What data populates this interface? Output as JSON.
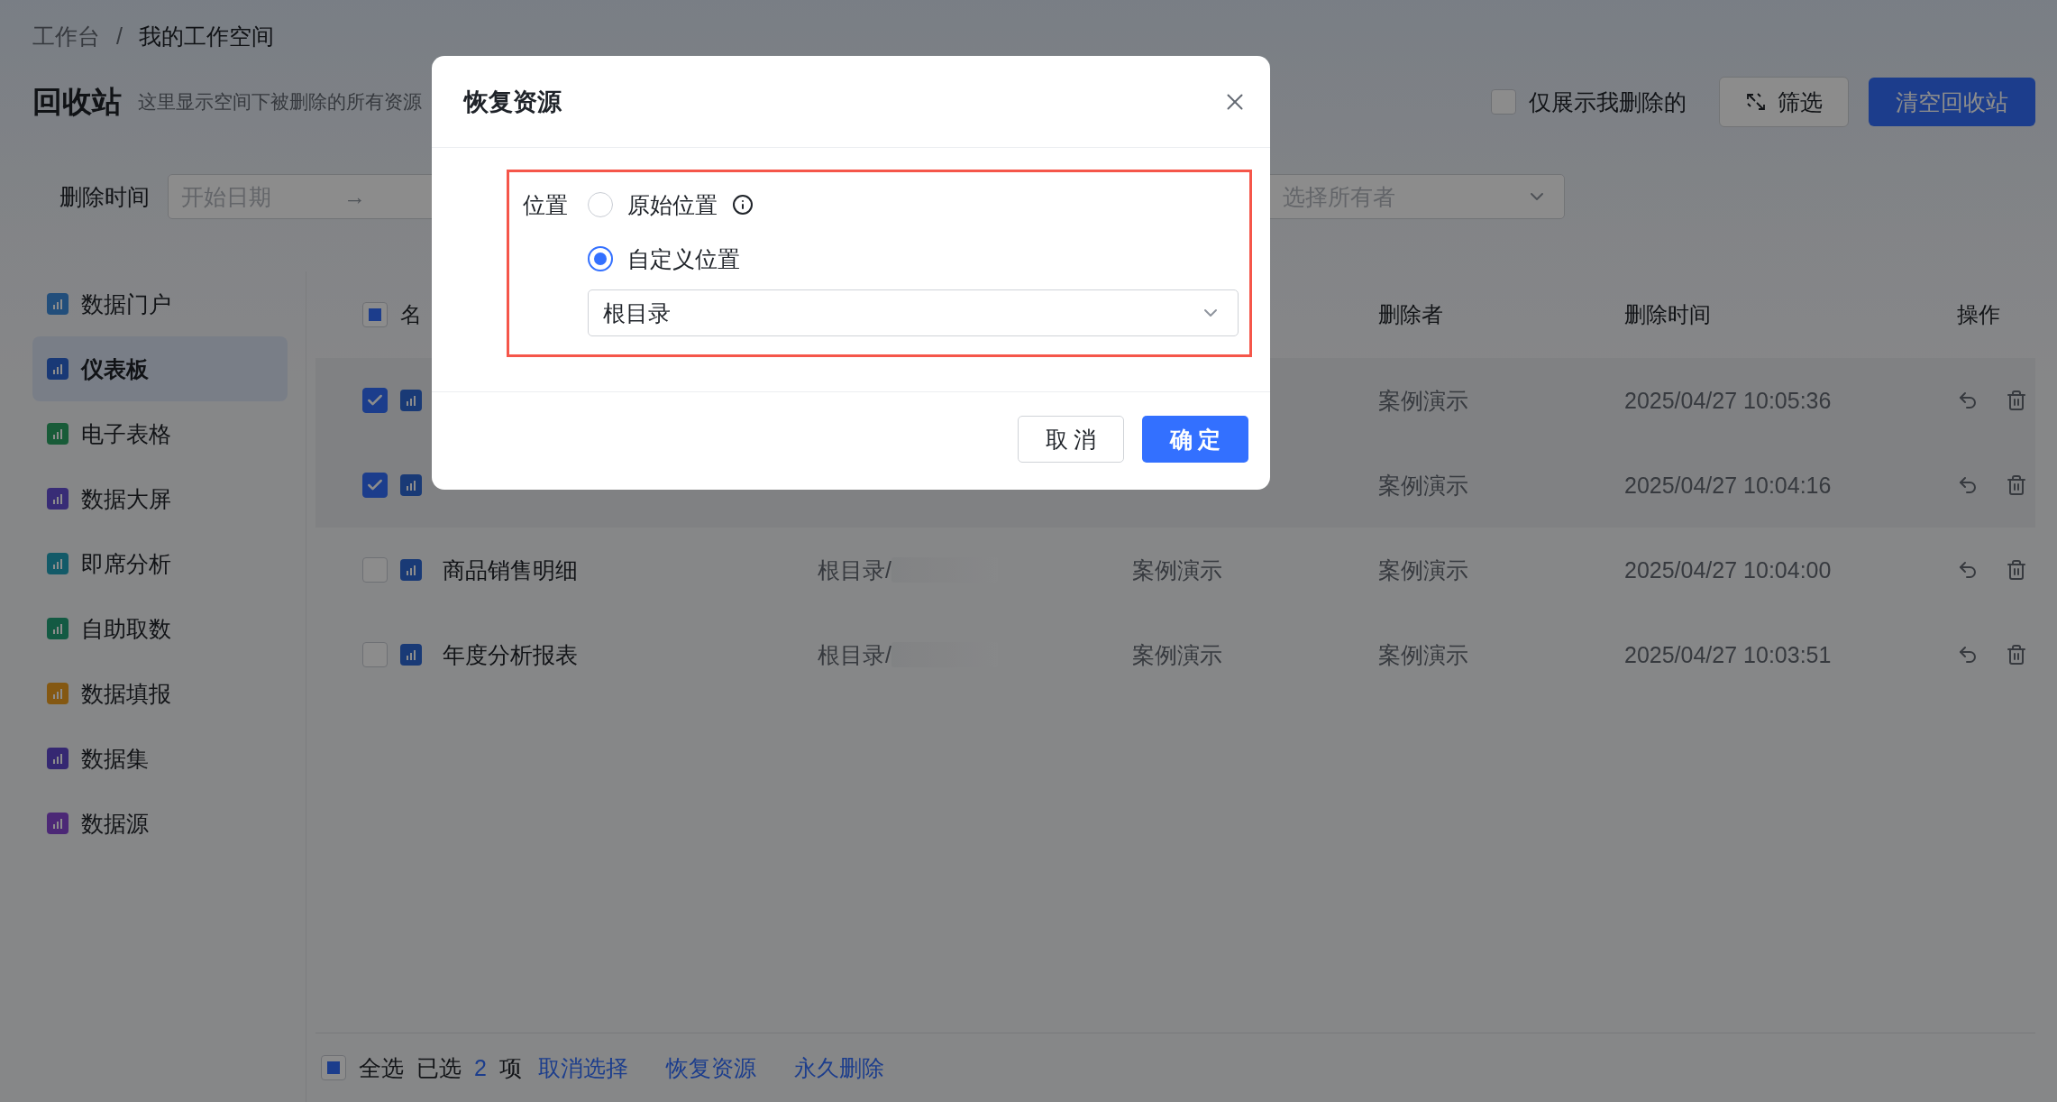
{
  "breadcrumb": {
    "items": [
      "工作台",
      "我的工作空间"
    ],
    "separator": "/"
  },
  "page": {
    "title": "回收站",
    "subtitle": "这里显示空间下被删除的所有资源"
  },
  "toolbar": {
    "only_mine": {
      "label": "仅展示我删除的",
      "checked": false
    },
    "filter_button": "筛选",
    "clear_button": "清空回收站"
  },
  "filters": {
    "delete_time_label": "删除时间",
    "start_placeholder": "开始日期",
    "arrow": "→",
    "owner_placeholder": "选择所有者"
  },
  "sidebar": {
    "items": [
      {
        "label": "数据门户",
        "selected": false,
        "color": "#224e7b"
      },
      {
        "label": "仪表板",
        "selected": true,
        "color": "#1a3a77"
      },
      {
        "label": "电子表格",
        "selected": false,
        "color": "#195c38"
      },
      {
        "label": "数据大屏",
        "selected": false,
        "color": "#382c77"
      },
      {
        "label": "即席分析",
        "selected": false,
        "color": "#145a68"
      },
      {
        "label": "自助取数",
        "selected": false,
        "color": "#135a43"
      },
      {
        "label": "数据填报",
        "selected": false,
        "color": "#845812"
      },
      {
        "label": "数据集",
        "selected": false,
        "color": "#362872"
      },
      {
        "label": "数据源",
        "selected": false,
        "color": "#4c2877"
      }
    ]
  },
  "table": {
    "select_all": {
      "checked": false,
      "indeterminate": true
    },
    "columns": {
      "name": "名",
      "deleted_by": "删除者",
      "deleted_at": "删除时间",
      "actions": "操作"
    },
    "rows": [
      {
        "selected": true,
        "deleted_by": "案例演示",
        "deleted_at": "2025/04/27 10:05:36"
      },
      {
        "selected": true,
        "deleted_by": "案例演示",
        "deleted_at": "2025/04/27 10:04:16"
      },
      {
        "selected": false,
        "name": "商品销售明细",
        "path": "根目录/",
        "path_blurred": true,
        "owner": "案例演示",
        "deleted_by": "案例演示",
        "deleted_at": "2025/04/27 10:04:00"
      },
      {
        "selected": false,
        "name": "年度分析报表",
        "path": "根目录/",
        "path_blurred": true,
        "owner": "案例演示",
        "deleted_by": "案例演示",
        "deleted_at": "2025/04/27 10:03:51"
      }
    ]
  },
  "bottom_bar": {
    "select_all": {
      "label": "全选",
      "checked": false,
      "indeterminate": true
    },
    "selected_prefix": "已选",
    "selected_count": "2",
    "selected_suffix": "项",
    "links": [
      "取消选择",
      "恢复资源",
      "永久删除"
    ]
  },
  "dialog": {
    "title": "恢复资源",
    "highlighted": true,
    "field_label": "位置",
    "options": [
      {
        "label": "原始位置",
        "selected": false,
        "info": true
      },
      {
        "label": "自定义位置",
        "selected": true,
        "info": false
      }
    ],
    "location_value": "根目录",
    "cancel": "取 消",
    "confirm": "确 定"
  }
}
